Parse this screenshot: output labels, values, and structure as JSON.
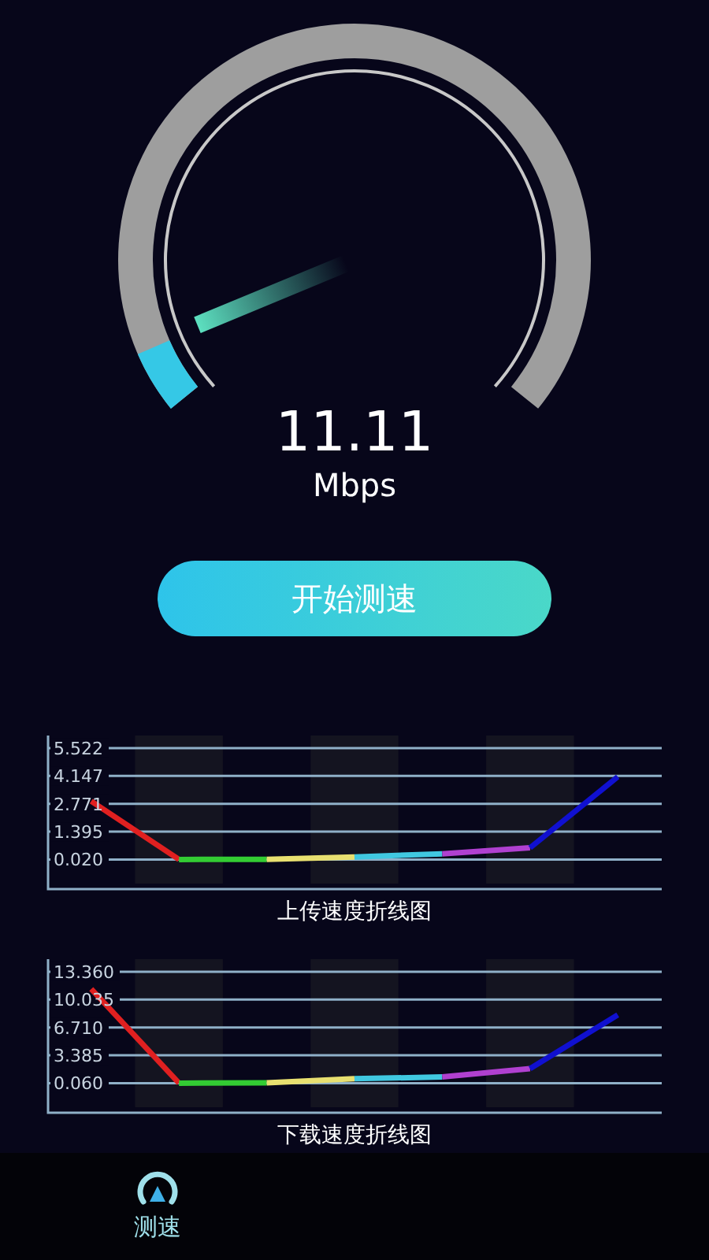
{
  "gauge": {
    "value": "11.11",
    "unit": "Mbps"
  },
  "start_button": {
    "label": "开始测速"
  },
  "upload_chart": {
    "chart_data": {
      "type": "line",
      "title": "上传速度折线图",
      "grid": true,
      "ylim": [
        -1.4,
        6.14
      ],
      "categories": [
        null,
        null,
        null,
        null,
        null,
        null,
        null
      ],
      "yticks": [
        {
          "value": 0.02,
          "label": "0.020"
        },
        {
          "value": 1.395,
          "label": "1.395"
        },
        {
          "value": 2.771,
          "label": "2.771"
        },
        {
          "value": 4.147,
          "label": "4.147"
        },
        {
          "value": 5.522,
          "label": "5.522"
        }
      ],
      "series": [
        {
          "color": "#e02020",
          "values": [
            2.9,
            0.02,
            null,
            null,
            null,
            null,
            null
          ]
        },
        {
          "color": "#33cc33",
          "values": [
            null,
            0.02,
            0.03,
            null,
            null,
            null,
            null
          ]
        },
        {
          "color": "#e8e070",
          "values": [
            null,
            null,
            0.03,
            0.15,
            null,
            null,
            null
          ]
        },
        {
          "color": "#40c8e0",
          "values": [
            null,
            null,
            null,
            0.15,
            0.3,
            null,
            null
          ]
        },
        {
          "color": "#b040d0",
          "values": [
            null,
            null,
            null,
            null,
            0.3,
            0.6,
            null
          ]
        },
        {
          "color": "#1010d0",
          "values": [
            null,
            null,
            null,
            null,
            null,
            0.6,
            4.1
          ]
        }
      ]
    }
  },
  "download_chart": {
    "chart_data": {
      "type": "line",
      "title": "下载速度折线图",
      "grid": true,
      "ylim": [
        -3.37,
        14.86
      ],
      "categories": [
        null,
        null,
        null,
        null,
        null,
        null,
        null
      ],
      "yticks": [
        {
          "value": 0.06,
          "label": "0.060"
        },
        {
          "value": 3.385,
          "label": "3.385"
        },
        {
          "value": 6.71,
          "label": "6.710"
        },
        {
          "value": 10.035,
          "label": "10.035"
        },
        {
          "value": 13.36,
          "label": "13.360"
        }
      ],
      "series": [
        {
          "color": "#e02020",
          "values": [
            11.3,
            0.06,
            null,
            null,
            null,
            null,
            null
          ]
        },
        {
          "color": "#33cc33",
          "values": [
            null,
            0.06,
            0.1,
            null,
            null,
            null,
            null
          ]
        },
        {
          "color": "#e8e070",
          "values": [
            null,
            null,
            0.1,
            0.6,
            null,
            null,
            null
          ]
        },
        {
          "color": "#40c8e0",
          "values": [
            null,
            null,
            null,
            0.6,
            0.8,
            null,
            null
          ]
        },
        {
          "color": "#b040d0",
          "values": [
            null,
            null,
            null,
            null,
            0.8,
            1.8,
            null
          ]
        },
        {
          "color": "#1010d0",
          "values": [
            null,
            null,
            null,
            null,
            null,
            1.8,
            8.2
          ]
        }
      ]
    }
  },
  "bottom_nav": {
    "items": [
      {
        "label": "测速",
        "selected": true
      }
    ]
  }
}
